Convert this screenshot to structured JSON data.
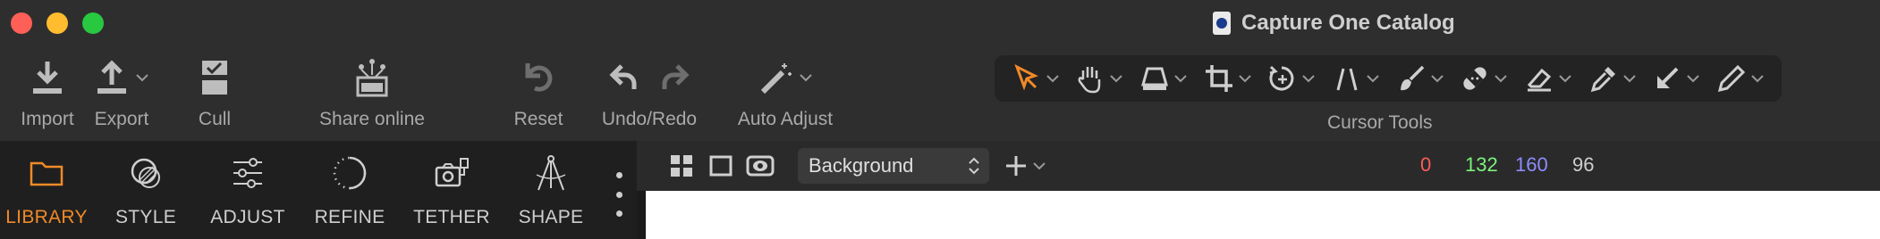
{
  "window": {
    "title": "Capture One Catalog"
  },
  "toolbar": {
    "import_label": "Import",
    "export_label": "Export",
    "cull_label": "Cull",
    "share_label": "Share online",
    "reset_label": "Reset",
    "undo_redo_label": "Undo/Redo",
    "auto_adjust_label": "Auto Adjust",
    "cursor_tools_label": "Cursor Tools"
  },
  "cursor_tools": [
    {
      "name": "select",
      "icon": "arrow-cursor-icon",
      "active": true
    },
    {
      "name": "pan",
      "icon": "hand-icon"
    },
    {
      "name": "loupe",
      "icon": "loupe-icon"
    },
    {
      "name": "crop",
      "icon": "crop-icon"
    },
    {
      "name": "rotate",
      "icon": "rotate-icon"
    },
    {
      "name": "keystone",
      "icon": "keystone-icon"
    },
    {
      "name": "brush",
      "icon": "brush-icon"
    },
    {
      "name": "heal",
      "icon": "bandage-icon"
    },
    {
      "name": "erase",
      "icon": "eraser-icon"
    },
    {
      "name": "picker",
      "icon": "eyedropper-icon"
    },
    {
      "name": "gradient",
      "icon": "gradient-mask-icon"
    },
    {
      "name": "annotate",
      "icon": "pen-icon"
    }
  ],
  "tabs": [
    {
      "label": "LIBRARY",
      "icon": "folder-icon",
      "active": true
    },
    {
      "label": "STYLE",
      "icon": "style-icon"
    },
    {
      "label": "ADJUST",
      "icon": "sliders-icon"
    },
    {
      "label": "REFINE",
      "icon": "refine-circle-icon"
    },
    {
      "label": "TETHER",
      "icon": "camera-tether-icon"
    },
    {
      "label": "SHAPE",
      "icon": "shape-compass-icon"
    }
  ],
  "viewer": {
    "variant_value": "Background",
    "readout": {
      "r": "0",
      "g": "132",
      "b": "160",
      "l": "96"
    }
  },
  "colors": {
    "accent": "#f08a28",
    "readout_r": "#ff5a5a",
    "readout_g": "#7cf27c",
    "readout_b": "#8c8cff"
  }
}
